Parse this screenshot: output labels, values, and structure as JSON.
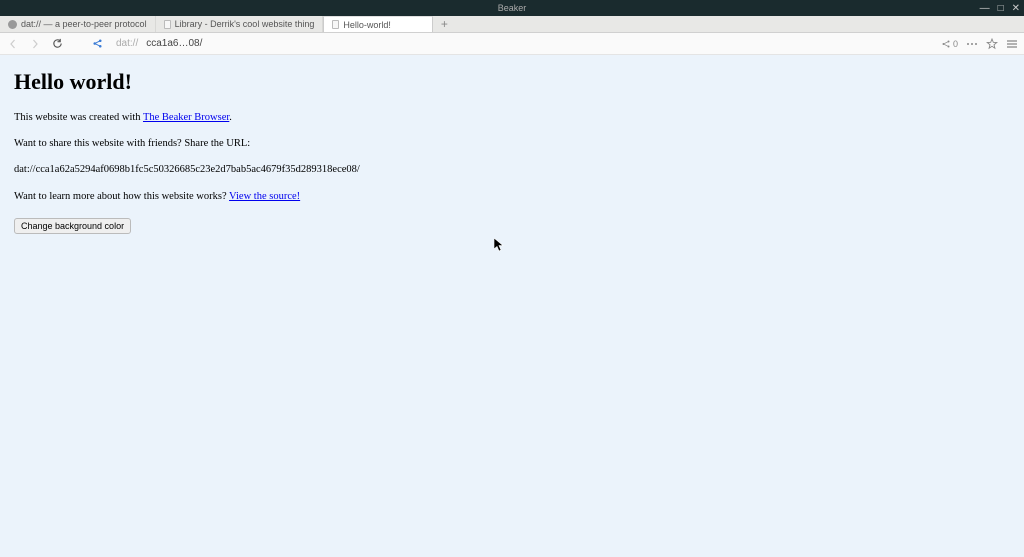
{
  "window": {
    "title": "Beaker",
    "controls": {
      "min": "—",
      "max": "□",
      "close": "✕"
    }
  },
  "tabs": [
    {
      "title": "dat:// — a peer-to-peer protocol",
      "favicon": "dot",
      "active": false
    },
    {
      "title": "Library - Derrik's cool website thing",
      "favicon": "paper",
      "active": false
    },
    {
      "title": "Hello-world!",
      "favicon": "paper",
      "active": true
    }
  ],
  "newTab": "+",
  "addressbar": {
    "prefix": "dat://",
    "url": "cca1a6…08/",
    "shareCount": "0"
  },
  "page": {
    "heading": "Hello world!",
    "p1_prefix": "This website was created with ",
    "p1_link": "The Beaker Browser",
    "p1_suffix": ".",
    "p2": "Want to share this website with friends? Share the URL:",
    "p3": "dat://cca1a62a5294af0698b1fc5c50326685c23e2d7bab5ac4679f35d289318ece08/",
    "p4_prefix": "Want to learn more about how this website works? ",
    "p4_link": "View the source!",
    "button": "Change background color"
  }
}
